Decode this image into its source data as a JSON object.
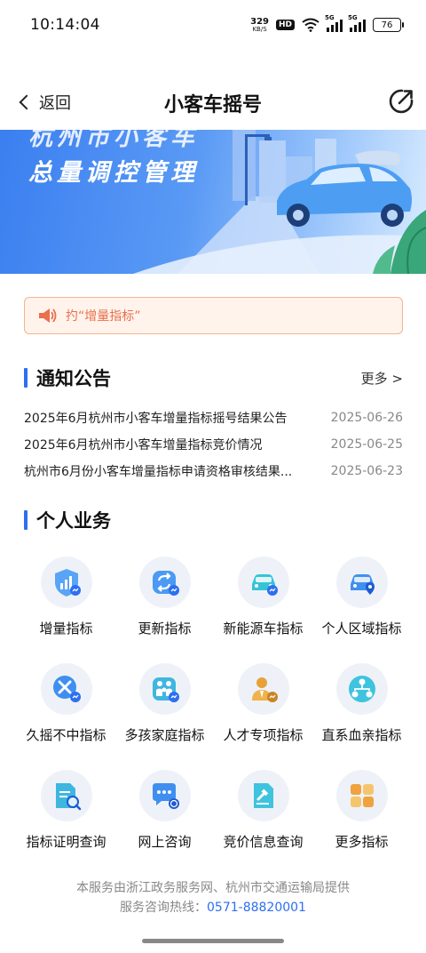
{
  "status_bar": {
    "time": "10:14:04",
    "net_speed": "329",
    "net_unit": "KB/S",
    "hd": "HD",
    "sig1": "5G",
    "sig2": "5G",
    "battery": "76"
  },
  "header": {
    "back_label": "返回",
    "title": "小客车摇号"
  },
  "banner": {
    "line1": "杭州市小客车",
    "line2": "总量调控管理"
  },
  "notice": {
    "text": "扚“增量指标”"
  },
  "announcements": {
    "title": "通知公告",
    "more": "更多 >",
    "items": [
      {
        "title": "2025年6月杭州市小客车增量指标摇号结果公告",
        "date": "2025-06-26"
      },
      {
        "title": "2025年6月杭州市小客车增量指标竞价情况",
        "date": "2025-06-25"
      },
      {
        "title": "杭州市6月份小客车增量指标申请资格审核结果...",
        "date": "2025-06-23"
      }
    ]
  },
  "services": {
    "title": "个人业务",
    "items": [
      {
        "label": "增量指标",
        "icon": "shield-chart-icon"
      },
      {
        "label": "更新指标",
        "icon": "refresh-icon"
      },
      {
        "label": "新能源车指标",
        "icon": "ev-car-icon"
      },
      {
        "label": "个人区域指标",
        "icon": "car-location-icon"
      },
      {
        "label": "久摇不中指标",
        "icon": "cross-icon"
      },
      {
        "label": "多孩家庭指标",
        "icon": "family-icon"
      },
      {
        "label": "人才专项指标",
        "icon": "talent-icon"
      },
      {
        "label": "直系血亲指标",
        "icon": "relation-icon"
      },
      {
        "label": "指标证明查询",
        "icon": "document-search-icon"
      },
      {
        "label": "网上咨询",
        "icon": "chat-icon"
      },
      {
        "label": "竞价信息查询",
        "icon": "auction-icon"
      },
      {
        "label": "更多指标",
        "icon": "grid-icon"
      }
    ]
  },
  "footer": {
    "line1": "本服务由浙江政务服务网、杭州市交通运输局提供",
    "hotline_label": "服务咨询热线：",
    "hotline": "0571-88820001"
  },
  "colors": {
    "accent": "#2d6ff0",
    "notice_text": "#e8704a",
    "notice_bg": "#fff3ec"
  }
}
